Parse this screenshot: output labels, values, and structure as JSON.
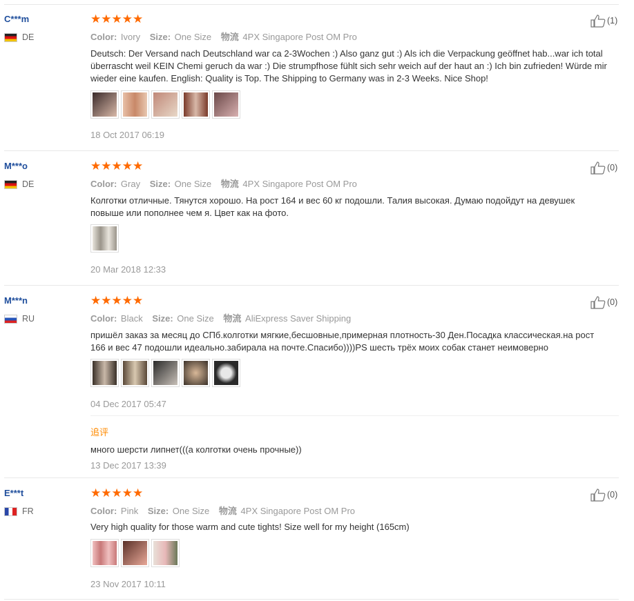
{
  "colors": {
    "star": "#ff6a00",
    "username": "#1f4e9c",
    "followup": "#ff8a00",
    "meta": "#999999"
  },
  "labels": {
    "color": "Color:",
    "size": "Size:",
    "logistics": "物流"
  },
  "reviews": [
    {
      "user": "C***m",
      "country": "DE",
      "flag": "flag-de",
      "stars": "★★★★★",
      "rating": 5,
      "color": "Ivory",
      "size": "One Size",
      "shipping": "4PX Singapore Post OM Pro",
      "text": "Deutsch: Der Versand nach Deutschland war ca 2-3Wochen :) Also ganz gut :) Als ich die Verpackung geöffnet hab...war ich total überrascht weil KEIN Chemi geruch da war :) Die strumpfhose fühlt sich sehr weich auf der haut an :) Ich bin zufrieden! Würde mir wieder eine kaufen. English: Quality is Top. The Shipping to Germany was in 2-3 Weeks. Nice Shop!",
      "date": "18 Oct 2017 06:19",
      "helpful": "(1)",
      "photos": [
        "#b88a7a",
        "#d9a58a",
        "#c99a88",
        "#8a4a3a",
        "#a87a78"
      ]
    },
    {
      "user": "M***o",
      "country": "DE",
      "flag": "flag-de",
      "stars": "★★★★★",
      "rating": 5,
      "color": "Gray",
      "size": "One Size",
      "shipping": "4PX Singapore Post OM Pro",
      "text": "Колготки отличные. Тянутся хорошо. На рост 164 и вес 60 кг подошли. Талия высокая. Думаю подойдут на девушек повыше или пополнее чем я. Цвет как на фото.",
      "date": "20 Mar 2018 12:33",
      "helpful": "(0)",
      "photos": [
        "#c8c2b8"
      ]
    },
    {
      "user": "M***n",
      "country": "RU",
      "flag": "flag-ru",
      "stars": "★★★★★",
      "rating": 5,
      "color": "Black",
      "size": "One Size",
      "shipping": "AliExpress Saver Shipping",
      "text": "пришёл заказ за месяц до СПб.колготки мягкие,бесшовные,примерная плотность-30 Ден.Посадка классическая.на рост 166 и вес 47 подошли идеально.забирала на почте.Спасибо))))PS шесть трёх моих собак станет неимоверно",
      "date": "04 Dec 2017 05:47",
      "helpful": "(0)",
      "photos": [
        "#5a4a3a",
        "#6a5848",
        "#4a4038",
        "#8a7868",
        "#3a3a3a"
      ],
      "followup": {
        "label": "追评",
        "text": "много шерсти липнет(((а колготки очень прочные))",
        "date": "13 Dec 2017 13:39"
      }
    },
    {
      "user": "E***t",
      "country": "FR",
      "flag": "flag-fr",
      "stars": "★★★★★",
      "rating": 5,
      "color": "Pink",
      "size": "One Size",
      "shipping": "4PX Singapore Post OM Pro",
      "text": "Very high quality for those warm and cute tights! Size well for my height (165cm)",
      "date": "23 Nov 2017 10:11",
      "helpful": "(0)",
      "photos": [
        "#e0a8a8",
        "#b87868",
        "#8a9a78"
      ]
    }
  ]
}
